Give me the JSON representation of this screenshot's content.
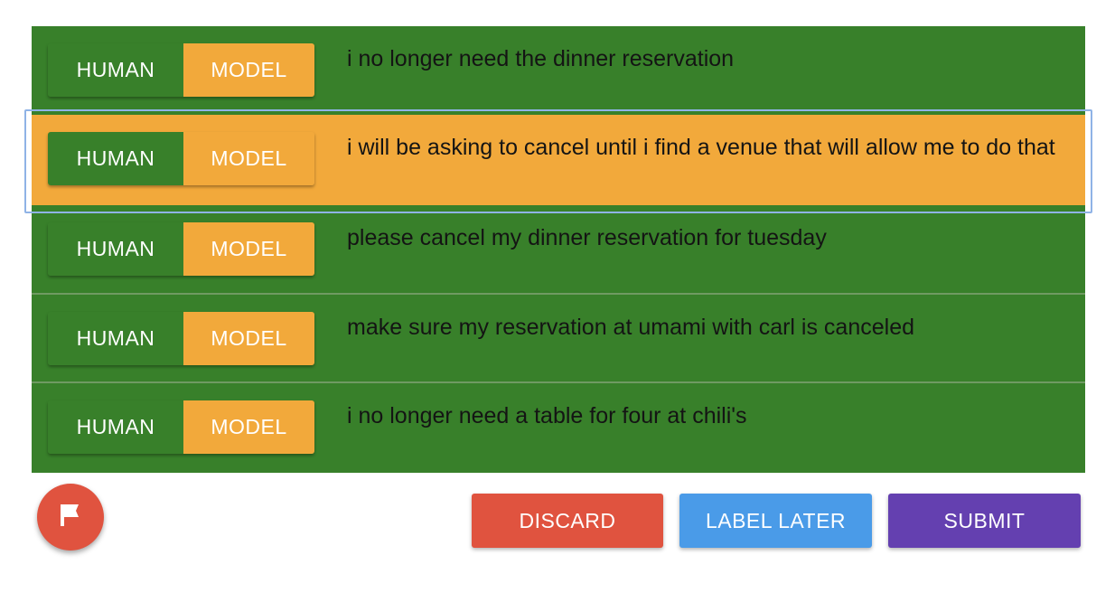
{
  "labels": {
    "human": "HUMAN",
    "model": "MODEL"
  },
  "utterances": [
    {
      "text": "i no longer need the dinner reservation",
      "selected": false
    },
    {
      "text": "i will be asking to cancel until i find a venue that will allow me to do that",
      "selected": true
    },
    {
      "text": "please cancel my dinner reservation for tuesday",
      "selected": false
    },
    {
      "text": "make sure my reservation at umami with carl is canceled",
      "selected": false
    },
    {
      "text": "i no longer need a table for four at chili's",
      "selected": false
    }
  ],
  "actions": {
    "discard_label": "DISCARD",
    "label_later_label": "LABEL LATER",
    "submit_label": "SUBMIT"
  },
  "flag_button": {
    "icon": "flag-icon"
  },
  "colors": {
    "human_green": "#38802a",
    "model_orange": "#f2a93b",
    "discard_red": "#e0533f",
    "label_later_blue": "#4a9be8",
    "submit_purple": "#6440b0",
    "flag_red": "#e0533f"
  }
}
